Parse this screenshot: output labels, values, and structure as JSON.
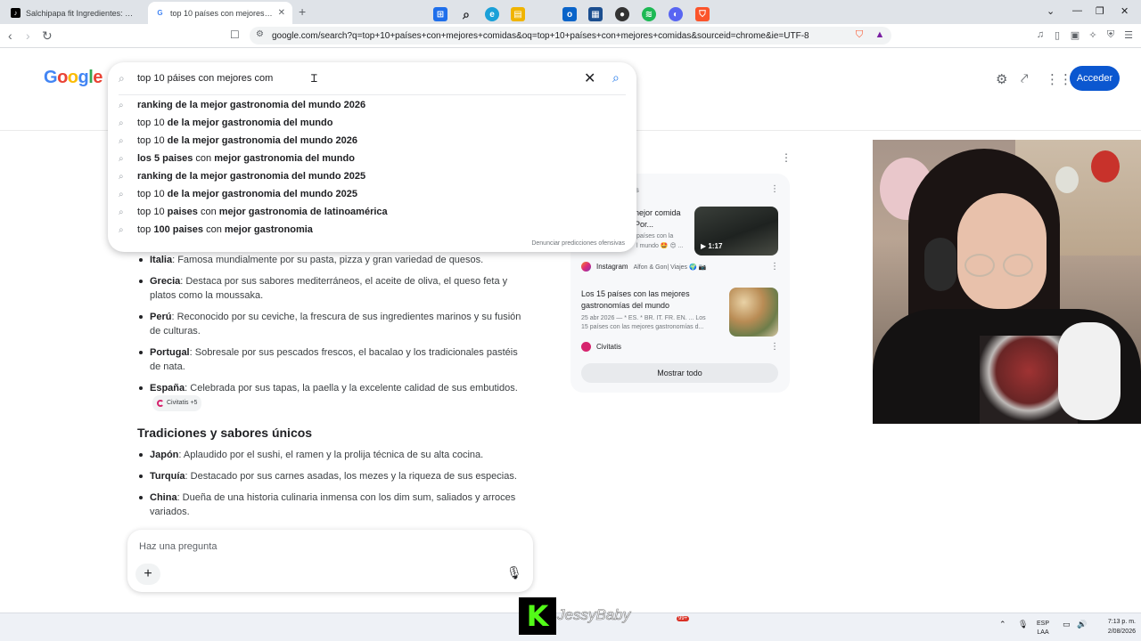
{
  "tabs": [
    {
      "title": "Salchipapa fit Ingredientes: Papa pero...",
      "active": false
    },
    {
      "title": "top 10 países con mejores comid...",
      "active": true
    }
  ],
  "address": {
    "url": "google.com/search?q=top+10+países+con+mejores+comidas&oq=top+10+países+con+mejores+comidas&sourceid=chrome&ie=UTF-8"
  },
  "google": {
    "logo_letters": [
      "G",
      "o",
      "o",
      "g",
      "l",
      "e"
    ],
    "search_query": "top 10 páises con mejores com",
    "signin_label": "Acceder",
    "report_link": "Denunciar predicciones ofensivas",
    "suggestions": [
      {
        "plain": "",
        "bold": "ranking de la mejor gastronomia del mundo 2026"
      },
      {
        "plain": "top 10 ",
        "bold": "de la mejor gastronomia del mundo"
      },
      {
        "plain": "top 10 ",
        "bold": "de la mejor gastronomia del mundo 2026"
      },
      {
        "plain": "",
        "bold": "los 5 paises",
        "plain2": " con ",
        "bold2": "mejor gastronomia del mundo"
      },
      {
        "plain": "",
        "bold": "ranking de la mejor gastronomia del mundo 2025"
      },
      {
        "plain": "top 10 ",
        "bold": "de la mejor gastronomia del mundo 2025"
      },
      {
        "plain": "top 10 ",
        "bold": "paises",
        "plain2": " con ",
        "bold2": "mejor gastronomia de latinoamérica"
      },
      {
        "plain": "top ",
        "bold": "100 paises",
        "plain2": " con ",
        "bold2": "mejor gastronomia"
      }
    ]
  },
  "answer": {
    "items": [
      {
        "name": "Italia",
        "text": ": Famosa mundialmente por su pasta, pizza y gran variedad de quesos."
      },
      {
        "name": "Grecia",
        "text": ": Destaca por sus sabores mediterráneos, el aceite de oliva, el queso feta y platos como la moussaka."
      },
      {
        "name": "Perú",
        "text": ": Reconocido por su ceviche, la frescura de sus ingredientes marinos y su fusión de culturas."
      },
      {
        "name": "Portugal",
        "text": ": Sobresale por sus pescados frescos, el bacalao y los tradicionales pastéis de nata."
      },
      {
        "name": "España",
        "text": ": Celebrada por sus tapas, la paella y la excelente calidad de sus embutidos."
      }
    ],
    "chip_label": "Civitatis +5",
    "section_title": "Tradiciones y sabores únicos",
    "items2": [
      {
        "name": "Japón",
        "text": ": Aplaudido por el sushi, el ramen y la prolija técnica de su alta cocina."
      },
      {
        "name": "Turquía",
        "text": ": Destacado por sus carnes asadas, los mezes y la riqueza de sus especias."
      },
      {
        "name": "China",
        "text": ": Dueña de una historia culinaria inmensa con los dim sum, saliados y arroces variados."
      }
    ],
    "ask_placeholder": "Haz una pregunta"
  },
  "side_panel": {
    "label": "dos",
    "card1": {
      "title_1": "nejor comida",
      "title_2": "Por...",
      "snippet_1": "países con la",
      "snippet_2": "l mundo 🤩 😍 ...",
      "duration": "▶ 1:17",
      "source": "Instagram",
      "source_sub": "Alfon & Gon| Viajes 🌍 📷"
    },
    "card2": {
      "title_1": "Los 15 países con las mejores",
      "title_2": "gastronomías del mundo",
      "snippet_1": "25 abr 2026 — * ES. * BR. IT. FR. EN. ... Los",
      "snippet_2": "15 países con las mejores gastronomías d...",
      "source": "Civitatis"
    },
    "show_all": "Mostrar todo"
  },
  "stream": {
    "channel_name": "JessyBaby",
    "platform_logo": "K"
  },
  "system": {
    "lang_1": "ESP",
    "lang_2": "LAA",
    "time": "7:13 p. m.",
    "date": "2/08/2026",
    "notif_badge": "99+"
  },
  "colors": {
    "google_blue": "#4285f4",
    "google_red": "#ea4335",
    "google_yellow": "#fbbc05",
    "google_green": "#34a853",
    "signin_bg": "#0b57d0",
    "kick_green": "#53fc18"
  }
}
